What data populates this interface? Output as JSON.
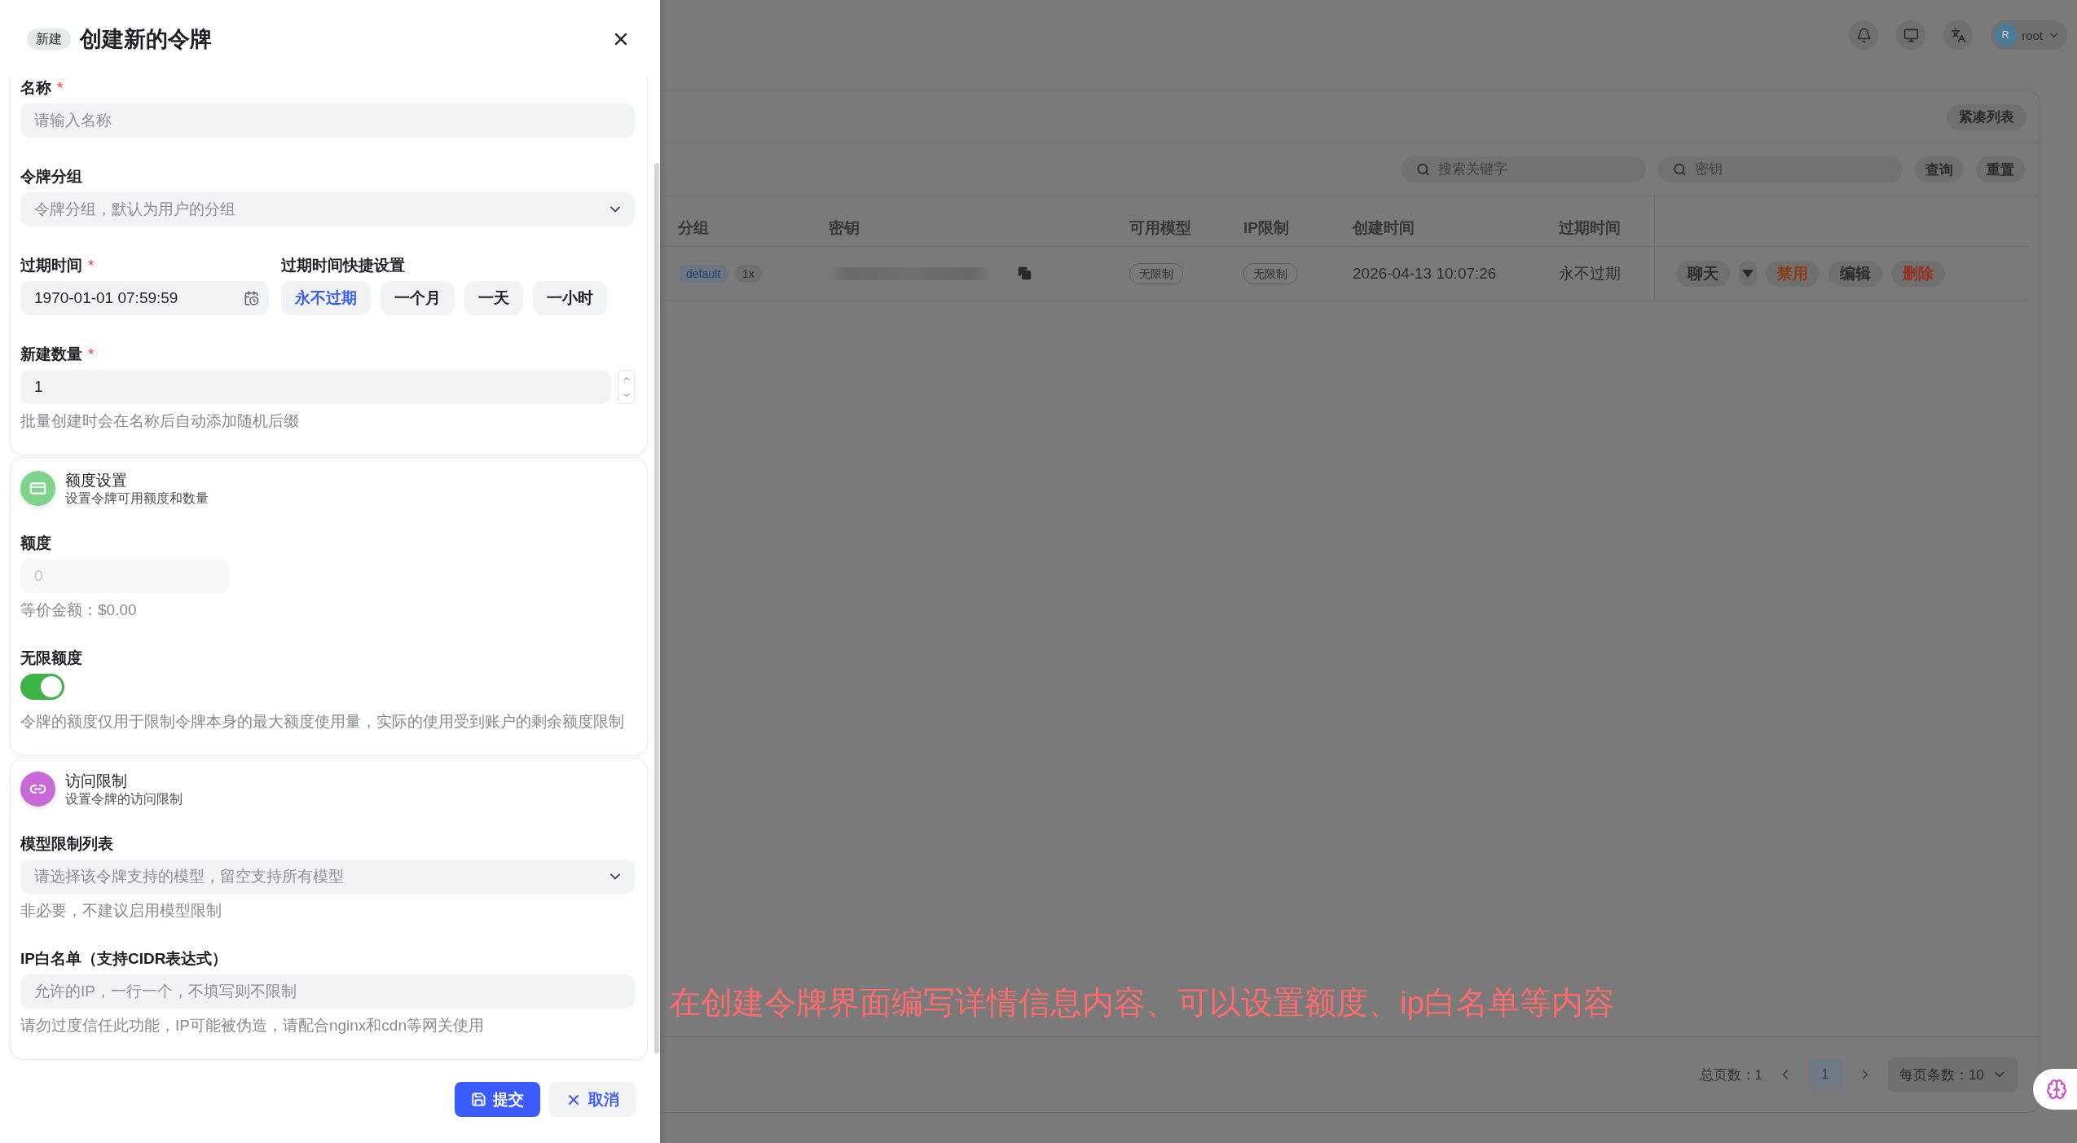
{
  "drawer": {
    "tag": "新建",
    "title": "创建新的令牌",
    "sections": [
      {
        "kind": "basic",
        "fields": [
          {
            "kind": "text",
            "label": "名称",
            "required_mark": "*",
            "placeholder": "请输入名称"
          },
          {
            "kind": "select",
            "label": "令牌分组",
            "placeholder": "令牌分组，默认为用户的分组"
          },
          {
            "kind": "expiry",
            "label": "过期时间",
            "required_mark": "*",
            "value": "1970-01-01 07:59:59",
            "quick_label": "过期时间快捷设置",
            "quick_options": [
              {
                "label": "永不过期",
                "selected": true
              },
              {
                "label": "一个月",
                "selected": false
              },
              {
                "label": "一天",
                "selected": false
              },
              {
                "label": "一小时",
                "selected": false
              }
            ]
          },
          {
            "kind": "number",
            "label": "新建数量",
            "required_mark": "*",
            "value": "1",
            "help": "批量创建时会在名称后自动添加随机后缀"
          }
        ]
      },
      {
        "kind": "quota",
        "color": "#7fd28a",
        "title": "额度设置",
        "subtitle": "设置令牌可用额度和数量",
        "fields": [
          {
            "kind": "amount",
            "label": "额度",
            "placeholder": "0",
            "disabled": true,
            "help": "等价金额：$0.00"
          },
          {
            "kind": "toggle",
            "label": "无限额度",
            "on": true,
            "help": "令牌的额度仅用于限制令牌本身的最大额度使用量，实际的使用受到账户的剩余额度限制"
          }
        ]
      },
      {
        "kind": "access",
        "color": "#c86ad5",
        "title": "访问限制",
        "subtitle": "设置令牌的访问限制",
        "fields": [
          {
            "kind": "select",
            "label": "模型限制列表",
            "placeholder": "请选择该令牌支持的模型，留空支持所有模型",
            "help": "非必要，不建议启用模型限制"
          },
          {
            "kind": "ip_list",
            "label": "IP白名单（支持CIDR表达式）",
            "placeholder": "允许的IP，一行一个，不填写则不限制",
            "help": "请勿过度信任此功能，IP可能被伪造，请配合nginx和cdn等网关使用"
          }
        ]
      }
    ],
    "buttons": [
      {
        "kind": "primary",
        "label": "提交"
      },
      {
        "kind": "secondary",
        "label": "取消"
      }
    ]
  },
  "header": {
    "user": {
      "initial": "R",
      "name": "root"
    }
  },
  "toolbar": {
    "compact_button": "紧凑列表",
    "filters": [
      {
        "placeholder": "搜索关键字"
      },
      {
        "placeholder": "密钥"
      }
    ],
    "buttons": [
      "查询",
      "重置"
    ]
  },
  "table": {
    "columns": [
      "分组",
      "密钥",
      "可用模型",
      "IP限制",
      "创建时间",
      "过期时间"
    ],
    "rows": [
      {
        "group": "default",
        "ratio": "1x",
        "models": "无限制",
        "ip_limit": "无限制",
        "created": "2026-04-13 10:07:26",
        "expires": "永不过期",
        "actions": [
          {
            "kind": "chat",
            "label": "聊天"
          },
          {
            "kind": "menu"
          },
          {
            "kind": "warning",
            "label": "禁用"
          },
          {
            "kind": "normal",
            "label": "编辑"
          },
          {
            "kind": "danger",
            "label": "删除"
          }
        ]
      }
    ]
  },
  "pagination": {
    "total": "总页数：1",
    "pages": [
      {
        "label": "1",
        "selected": true
      }
    ],
    "page_size": "每页条数：10"
  },
  "annotation": "在创建令牌界面编写详情信息内容、可以设置额度、ip白名单等内容"
}
